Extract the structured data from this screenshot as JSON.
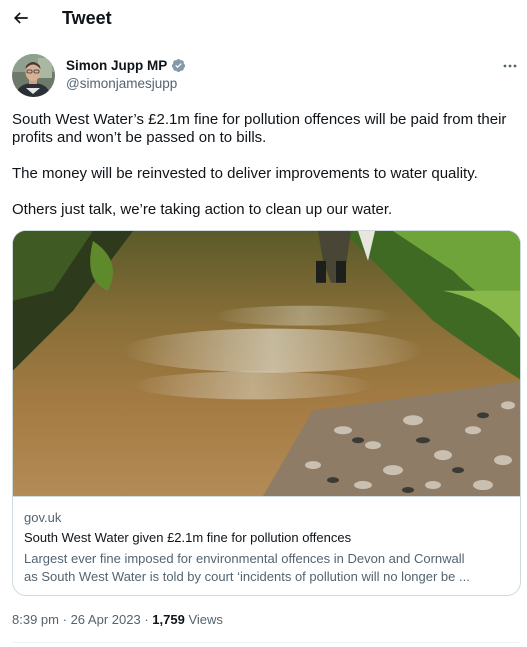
{
  "header": {
    "title": "Tweet",
    "back_icon": "arrow-left-icon"
  },
  "author": {
    "name": "Simon Jupp MP",
    "handle": "@simonjamesjupp",
    "verified_icon": "verified-badge-icon",
    "verified_color": "#829aab"
  },
  "tweet": {
    "paragraphs": [
      "South West Water’s £2.1m fine for pollution offences will be paid from their profits and won’t be passed on to bills.",
      "The money will be reinvested to deliver improvements to water quality.",
      "Others just talk, we’re taking action to clean up our water."
    ]
  },
  "card": {
    "domain": "gov.uk",
    "title": "South West Water given £2.1m fine for pollution offences",
    "description_line1": "Largest ever fine imposed for environmental offences in Devon and Cornwall",
    "description_line2": "as South West Water is told by court ‘incidents of pollution will no longer be ..."
  },
  "meta": {
    "time": "8:39 pm",
    "date": "26 Apr 2023",
    "views_count": "1,759",
    "views_label": "Views"
  },
  "colors": {
    "text": "#0f1419",
    "secondary": "#536471",
    "border": "#cfd9de"
  }
}
